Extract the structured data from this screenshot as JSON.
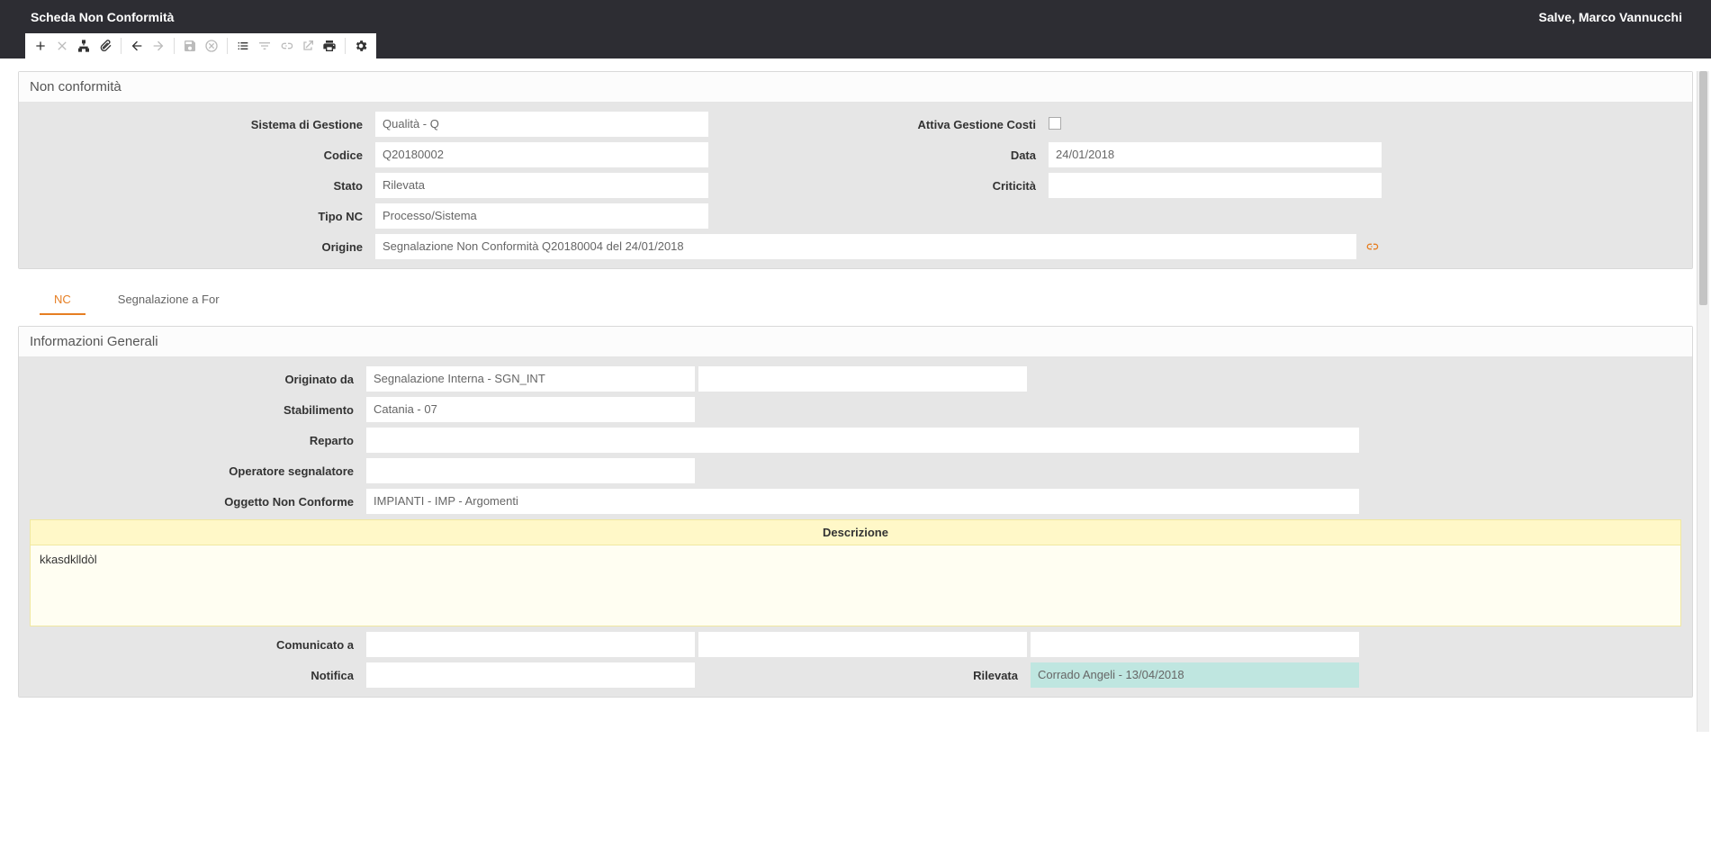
{
  "header": {
    "title": "Scheda Non Conformità",
    "user_greeting": "Salve, Marco Vannucchi"
  },
  "panel_nonconformita": {
    "title": "Non conformità",
    "labels": {
      "sistema_gestione": "Sistema di Gestione",
      "attiva_gestione_costi": "Attiva Gestione Costi",
      "codice": "Codice",
      "data": "Data",
      "stato": "Stato",
      "criticita": "Criticità",
      "tipo_nc": "Tipo NC",
      "origine": "Origine"
    },
    "values": {
      "sistema_gestione": "Qualità - Q",
      "codice": "Q20180002",
      "data": "24/01/2018",
      "stato": "Rilevata",
      "criticita": "",
      "tipo_nc": "Processo/Sistema",
      "origine": "Segnalazione Non Conformità  Q20180004 del 24/01/2018"
    }
  },
  "tabs": {
    "nc": "NC",
    "segnalazione": "Segnalazione a For"
  },
  "panel_info": {
    "title": "Informazioni Generali",
    "labels": {
      "originato_da": "Originato da",
      "stabilimento": "Stabilimento",
      "reparto": "Reparto",
      "operatore_segnalatore": "Operatore segnalatore",
      "oggetto_non_conforme": "Oggetto Non Conforme",
      "descrizione": "Descrizione",
      "comunicato_a": "Comunicato a",
      "notifica": "Notifica",
      "rilevata": "Rilevata"
    },
    "values": {
      "originato_da": "Segnalazione Interna - SGN_INT",
      "originato_da_extra": "",
      "stabilimento": "Catania - 07",
      "reparto": "",
      "operatore_segnalatore": "",
      "oggetto_non_conforme": "IMPIANTI - IMP - Argomenti",
      "descrizione": "kkasdklldòl",
      "comunicato_a_1": "",
      "comunicato_a_2": "",
      "comunicato_a_3": "",
      "notifica": "",
      "rilevata": "Corrado Angeli - 13/04/2018"
    }
  }
}
